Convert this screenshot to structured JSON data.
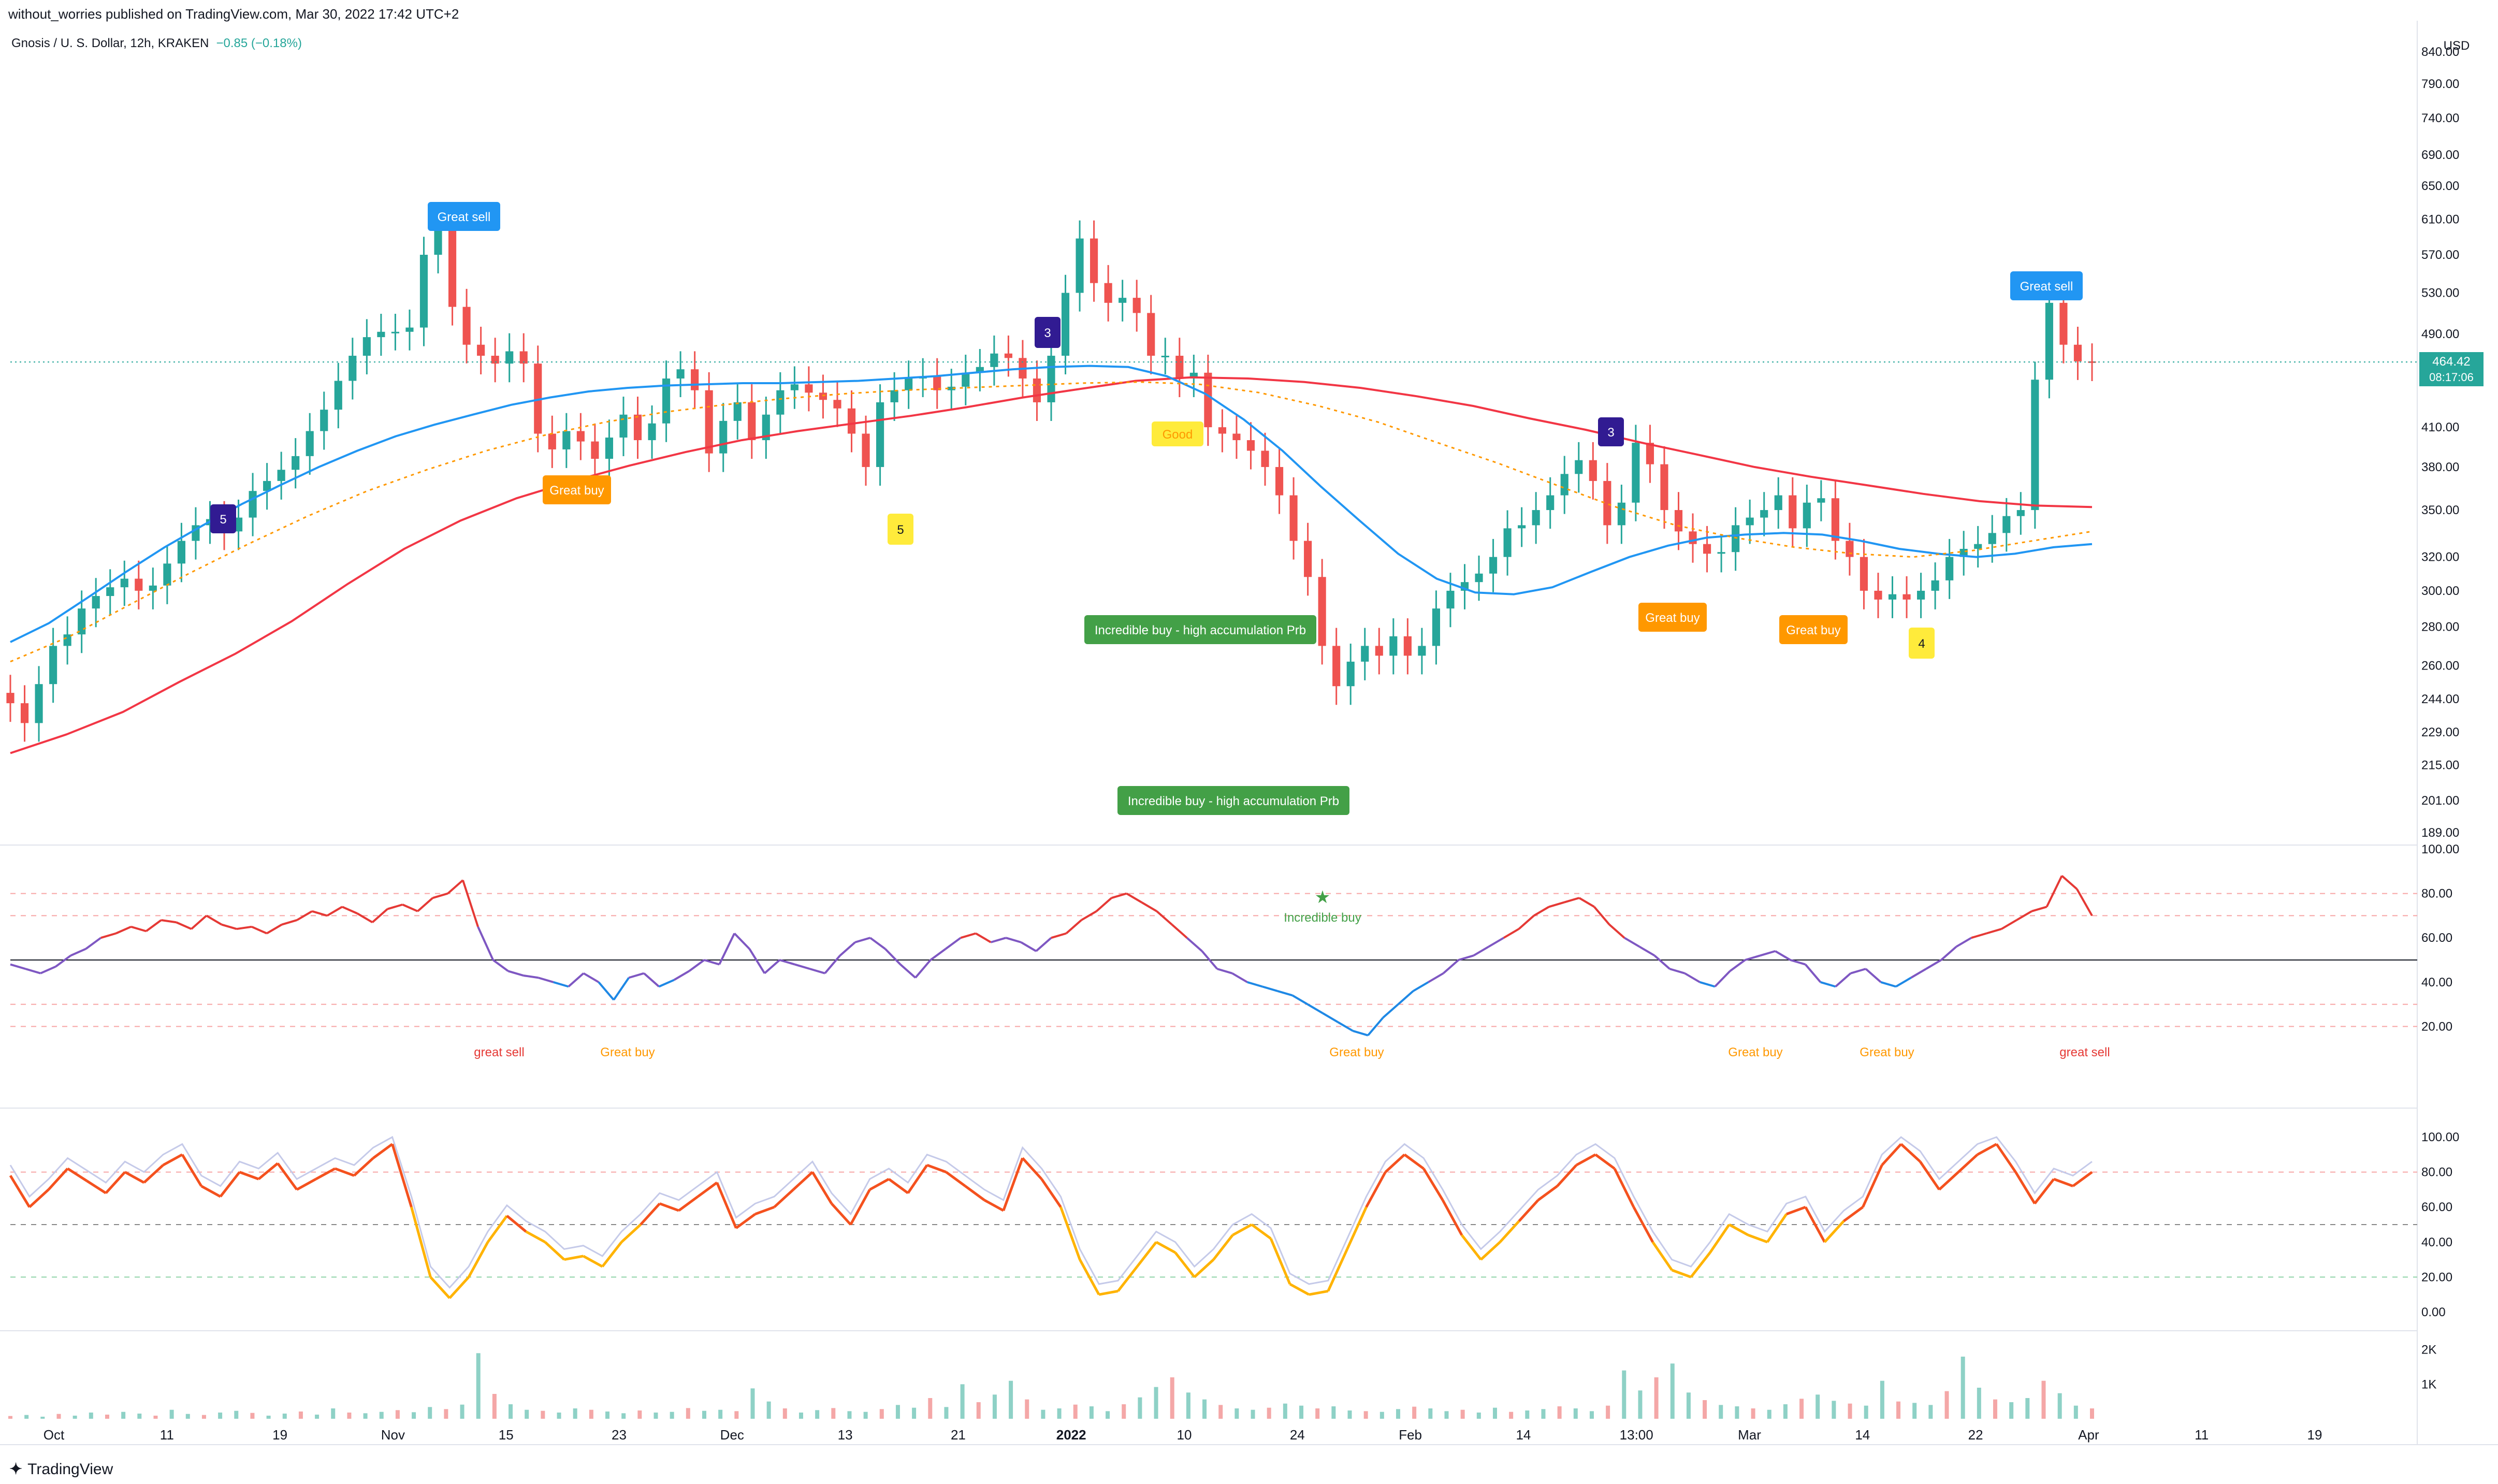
{
  "header": {
    "published": "without_worries published on TradingView.com, Mar 30, 2022 17:42 UTC+2"
  },
  "legend": {
    "symbol": "Gnosis / U. S. Dollar, 12h, KRAKEN",
    "change": "−0.85 (−0.18%)"
  },
  "currency": "USD",
  "price_label": {
    "price": "464.42",
    "countdown": "08:17:06"
  },
  "footer": {
    "brand": "TradingView"
  },
  "colors": {
    "up": "#26a69a",
    "down": "#ef5350",
    "ma_blue": "#2196f3",
    "ma_red": "#f23645",
    "ma_orange": "#ff9800",
    "label_blue": "#2196f3",
    "label_orange": "#ff9800",
    "label_green": "#43a047",
    "label_yellow": "#ffeb3b",
    "label_purple": "#311b92",
    "rsi_high": "#e53935",
    "rsi_low": "#1e88e5"
  },
  "chart_data": [
    {
      "type": "line",
      "name": "price",
      "y_ticks": [
        "840.00",
        "790.00",
        "740.00",
        "690.00",
        "650.00",
        "610.00",
        "570.00",
        "530.00",
        "490.00",
        "450.00",
        "410.00",
        "380.00",
        "350.00",
        "320.00",
        "300.00",
        "280.00",
        "260.00",
        "244.00",
        "229.00",
        "215.00",
        "201.00",
        "189.00"
      ],
      "x_ticks": [
        "Oct",
        "11",
        "19",
        "Nov",
        "15",
        "23",
        "Dec",
        "13",
        "21",
        "2022",
        "10",
        "24",
        "Feb",
        "14",
        "13:00",
        "Mar",
        "14",
        "22",
        "Apr",
        "11",
        "19"
      ],
      "close": [
        242,
        233,
        251,
        270,
        276,
        290,
        297,
        302,
        307,
        300,
        303,
        316,
        330,
        340,
        344,
        336,
        345,
        363,
        370,
        378,
        388,
        407,
        424,
        448,
        470,
        487,
        492,
        492,
        496,
        570,
        598,
        516,
        480,
        470,
        463,
        474,
        463,
        405,
        393,
        407,
        399,
        386,
        402,
        420,
        400,
        413,
        450,
        458,
        440,
        390,
        415,
        430,
        400,
        420,
        440,
        445,
        438,
        432,
        425,
        405,
        380,
        430,
        440,
        450,
        452,
        440,
        443,
        455,
        460,
        472,
        468,
        450,
        430,
        470,
        530,
        588,
        540,
        520,
        525,
        510,
        470,
        470,
        450,
        455,
        410,
        405,
        400,
        392,
        380,
        360,
        330,
        308,
        270,
        250,
        262,
        270,
        265,
        275,
        265,
        270,
        290,
        300,
        305,
        310,
        320,
        338,
        340,
        350,
        360,
        375,
        385,
        370,
        340,
        355,
        398,
        382,
        350,
        336,
        328,
        322,
        323,
        340,
        345,
        350,
        360,
        338,
        355,
        358,
        330,
        320,
        300,
        295,
        298,
        295,
        300,
        306,
        320,
        325,
        328,
        335,
        346,
        350,
        449,
        520,
        480,
        465,
        464
      ],
      "ma_blue": [
        272,
        282,
        296,
        311,
        326,
        340,
        354,
        367,
        380,
        392,
        403,
        412,
        420,
        428,
        434,
        439,
        442,
        444,
        445,
        446,
        446,
        447,
        448,
        450,
        452,
        455,
        458,
        460,
        461,
        460,
        452,
        437,
        416,
        392,
        366,
        343,
        322,
        307,
        299,
        298,
        302,
        311,
        320,
        327,
        332,
        334,
        335,
        334,
        330,
        325,
        322,
        320,
        322,
        326,
        328
      ],
      "ma_red": [
        220,
        228,
        238,
        252,
        266,
        283,
        304,
        325,
        343,
        358,
        370,
        381,
        391,
        400,
        407,
        413,
        419,
        426,
        434,
        441,
        448,
        451,
        450,
        447,
        442,
        435,
        427,
        417,
        408,
        398,
        389,
        380,
        373,
        367,
        361,
        356,
        353,
        352
      ],
      "ma_orange": [
        262,
        275,
        292,
        310,
        328,
        346,
        363,
        378,
        392,
        404,
        414,
        422,
        428,
        433,
        437,
        440,
        442,
        444,
        446,
        447,
        445,
        438,
        427,
        414,
        398,
        383,
        367,
        352,
        340,
        332,
        326,
        322,
        320,
        324,
        330,
        336
      ]
    },
    {
      "type": "line",
      "name": "RSI",
      "y_ticks": [
        "100.00",
        "80.00",
        "60.00",
        "40.00",
        "20.00"
      ],
      "ylim": [
        0,
        100
      ],
      "bands": [
        80,
        70,
        50,
        30,
        20
      ],
      "values": [
        48,
        46,
        44,
        47,
        52,
        55,
        60,
        62,
        65,
        63,
        68,
        67,
        64,
        70,
        66,
        64,
        65,
        62,
        66,
        68,
        72,
        70,
        74,
        71,
        67,
        73,
        75,
        72,
        78,
        80,
        86,
        65,
        50,
        45,
        43,
        42,
        40,
        38,
        44,
        40,
        32,
        42,
        44,
        38,
        41,
        45,
        50,
        48,
        62,
        55,
        44,
        50,
        48,
        46,
        44,
        52,
        58,
        60,
        55,
        48,
        42,
        50,
        55,
        60,
        62,
        58,
        60,
        58,
        54,
        60,
        62,
        68,
        72,
        78,
        80,
        76,
        72,
        66,
        60,
        54,
        46,
        44,
        40,
        38,
        36,
        34,
        30,
        26,
        22,
        18,
        16,
        24,
        30,
        36,
        40,
        44,
        50,
        52,
        56,
        60,
        64,
        70,
        74,
        76,
        78,
        74,
        66,
        60,
        56,
        52,
        46,
        44,
        40,
        38,
        45,
        50,
        52,
        54,
        50,
        48,
        40,
        38,
        44,
        46,
        40,
        38,
        42,
        46,
        50,
        56,
        60,
        62,
        64,
        68,
        72,
        74,
        88,
        82,
        70
      ]
    },
    {
      "type": "line",
      "name": "Stochastic",
      "y_ticks": [
        "100.00",
        "80.00",
        "60.00",
        "40.00",
        "20.00",
        "0.00"
      ],
      "ylim": [
        0,
        100
      ],
      "bands": [
        80,
        50,
        20
      ],
      "values": [
        78,
        60,
        70,
        82,
        75,
        68,
        80,
        74,
        84,
        90,
        72,
        66,
        80,
        76,
        85,
        70,
        76,
        82,
        78,
        88,
        96,
        60,
        20,
        8,
        20,
        40,
        55,
        46,
        40,
        30,
        32,
        26,
        40,
        50,
        62,
        58,
        66,
        74,
        48,
        56,
        60,
        70,
        80,
        62,
        50,
        70,
        76,
        68,
        84,
        80,
        72,
        64,
        58,
        88,
        76,
        60,
        30,
        10,
        12,
        26,
        40,
        34,
        20,
        30,
        44,
        50,
        42,
        16,
        10,
        12,
        36,
        60,
        80,
        90,
        82,
        64,
        44,
        30,
        40,
        52,
        64,
        72,
        84,
        90,
        82,
        60,
        40,
        24,
        20,
        34,
        50,
        44,
        40,
        56,
        60,
        40,
        52,
        60,
        84,
        96,
        86,
        70,
        80,
        90,
        96,
        80,
        62,
        76,
        72,
        80
      ]
    },
    {
      "type": "bar",
      "name": "Volume",
      "y_ticks": [
        "2K",
        "1K"
      ],
      "ylim": [
        0,
        2400
      ],
      "values": [
        80,
        110,
        60,
        140,
        90,
        180,
        120,
        200,
        150,
        90,
        260,
        140,
        110,
        180,
        230,
        170,
        90,
        150,
        210,
        120,
        300,
        180,
        160,
        200,
        250,
        190,
        340,
        280,
        410,
        1900,
        720,
        420,
        260,
        230,
        180,
        300,
        260,
        210,
        160,
        240,
        180,
        200,
        310,
        230,
        260,
        220,
        880,
        500,
        300,
        180,
        250,
        310,
        220,
        200,
        280,
        400,
        320,
        600,
        340,
        1000,
        480,
        700,
        1100,
        560,
        260,
        300,
        410,
        360,
        220,
        420,
        620,
        920,
        1200,
        760,
        560,
        400,
        300,
        260,
        320,
        440,
        380,
        300,
        360,
        240,
        220,
        200,
        280,
        350,
        300,
        220,
        260,
        180,
        320,
        200,
        240,
        280,
        360,
        300,
        220,
        380,
        1400,
        820,
        1200,
        1600,
        760,
        540,
        400,
        360,
        300,
        260,
        420,
        580,
        700,
        520,
        440,
        380,
        1100,
        500,
        460,
        400,
        800,
        1800,
        900,
        560,
        480,
        600,
        1100,
        740,
        380,
        300
      ]
    }
  ],
  "signals": [
    {
      "text": "Great sell"
    },
    {
      "text": "Great buy"
    },
    {
      "text": "5"
    },
    {
      "text": "5"
    },
    {
      "text": "3"
    },
    {
      "text": "Good"
    },
    {
      "text": "Incredible buy - high accumulation Prb"
    },
    {
      "text": "Incredible buy - high accumulation Prb"
    },
    {
      "text": "3"
    },
    {
      "text": "Great buy"
    },
    {
      "text": "Great buy"
    },
    {
      "text": "4"
    },
    {
      "text": "Great sell"
    }
  ],
  "rsi_labels": [
    "great sell",
    "Great buy",
    "Incredible buy",
    "Great buy",
    "Great buy",
    "Great buy",
    "great sell"
  ]
}
